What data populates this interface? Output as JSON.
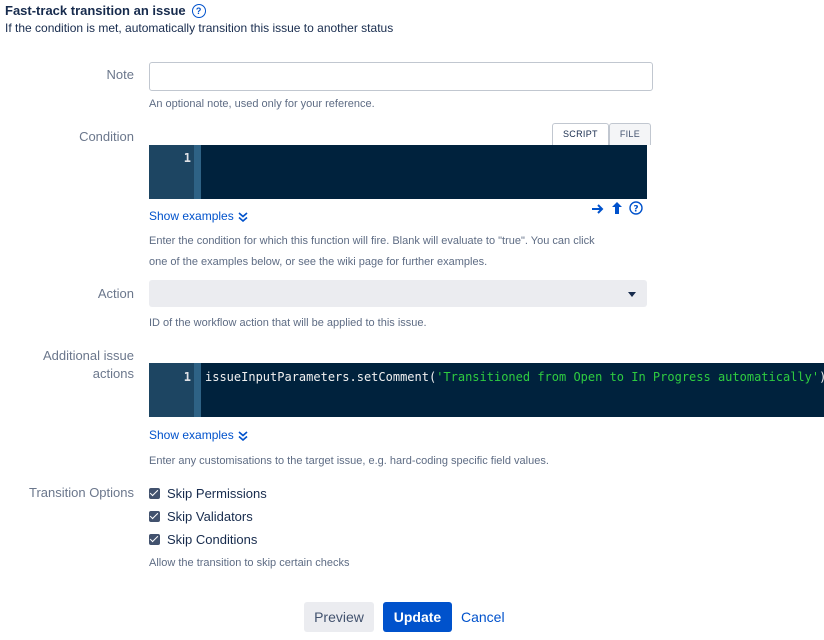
{
  "header": {
    "title": "Fast-track transition an issue",
    "help_glyph": "?",
    "subtitle": "If the condition is met, automatically transition this issue to another status"
  },
  "note": {
    "label": "Note",
    "value": "",
    "placeholder": "",
    "description": "An optional note, used only for your reference."
  },
  "condition": {
    "label": "Condition",
    "tabs": [
      "SCRIPT",
      "FILE"
    ],
    "active_tab": "SCRIPT",
    "line_number": "1",
    "code": "",
    "show_examples": "Show examples",
    "description_line1": "Enter the condition for which this function will fire. Blank will evaluate to \"true\". You can click",
    "description_line2": "one of the examples below, or see the wiki page for further examples.",
    "tool_icons": [
      "arrow-right-icon",
      "upload-icon",
      "help-icon"
    ]
  },
  "action": {
    "label": "Action",
    "selected_value": "",
    "description": "ID of the workflow action that will be applied to this issue."
  },
  "additional_actions": {
    "label_line1": "Additional issue",
    "label_line2": "actions",
    "line_number": "1",
    "code_prefix": "issueInputParameters.setComment(",
    "code_string": "'Transitioned from Open to In Progress automatically'",
    "code_suffix": ")",
    "show_examples": "Show examples",
    "description": "Enter any customisations to the target issue, e.g. hard-coding specific field values."
  },
  "transition_options": {
    "label": "Transition Options",
    "options": [
      {
        "label": "Skip Permissions",
        "checked": true
      },
      {
        "label": "Skip Validators",
        "checked": true
      },
      {
        "label": "Skip Conditions",
        "checked": true
      }
    ],
    "description": "Allow the transition to skip certain checks"
  },
  "buttons": {
    "preview": "Preview",
    "update": "Update",
    "cancel": "Cancel"
  },
  "colors": {
    "editor_bg": "#00223d",
    "primary": "#0052cc",
    "string": "#2ecc40"
  }
}
